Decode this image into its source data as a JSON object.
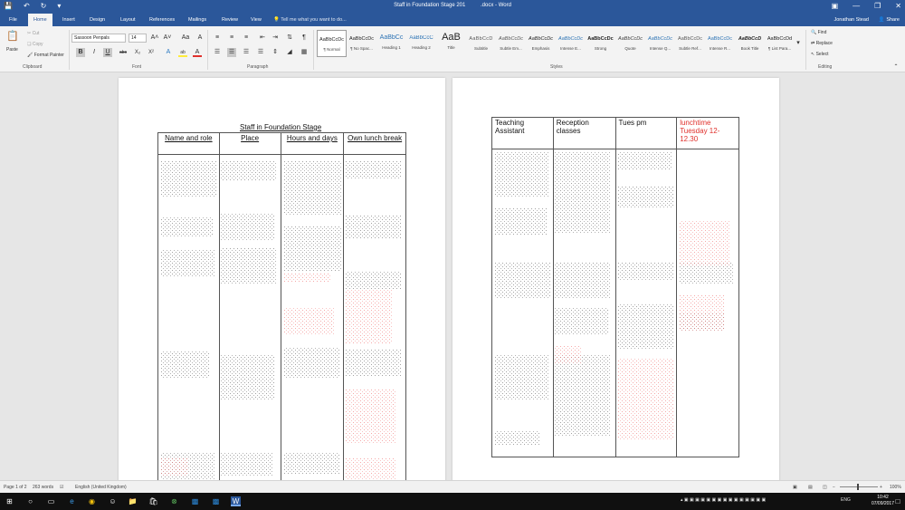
{
  "window": {
    "title": "Staff in Foundation Stage 201          .docx - Word",
    "minimize": "—",
    "restore": "❐",
    "close": "✕"
  },
  "tabs": [
    "File",
    "Home",
    "Insert",
    "Design",
    "Layout",
    "References",
    "Mailings",
    "Review",
    "View"
  ],
  "tell_me": "Tell me what you want to do...",
  "user": "Jonathan Stead",
  "share": "Share",
  "ribbon": {
    "clipboard": {
      "paste": "Paste",
      "cut": "Cut",
      "copy": "Copy",
      "format_painter": "Format Painter",
      "label": "Clipboard"
    },
    "font": {
      "name": "Sassoon Penpals",
      "size": "14",
      "label": "Font",
      "grow": "A˄",
      "shrink": "A˅",
      "case": "Aa",
      "clear": "A",
      "bold": "B",
      "italic": "I",
      "underline": "U",
      "strike": "abc",
      "sub": "X₂",
      "sup": "X²",
      "effects": "A",
      "highlight": "ab",
      "color": "A"
    },
    "paragraph": {
      "label": "Paragraph",
      "pilcrow": "¶"
    },
    "styles": {
      "label": "Styles",
      "items": [
        {
          "preview": "AaBbCcDc",
          "name": "¶ Normal"
        },
        {
          "preview": "AaBbCcDc",
          "name": "¶ No Spac..."
        },
        {
          "preview": "AaBbCc",
          "name": "Heading 1"
        },
        {
          "preview": "AaBbCcC",
          "name": "Heading 2"
        },
        {
          "preview": "AaB",
          "name": "Title"
        },
        {
          "preview": "AaBbCcD",
          "name": "Subtitle"
        },
        {
          "preview": "AaBbCcDc",
          "name": "Subtle Em..."
        },
        {
          "preview": "AaBbCcDc",
          "name": "Emphasis"
        },
        {
          "preview": "AaBbCcDc",
          "name": "Intense E..."
        },
        {
          "preview": "AaBbCcDc",
          "name": "Strong"
        },
        {
          "preview": "AaBbCcDc",
          "name": "Quote"
        },
        {
          "preview": "AaBbCcDc",
          "name": "Intense Q..."
        },
        {
          "preview": "AaBbCcDc",
          "name": "Subtle Ref..."
        },
        {
          "preview": "AaBbCcDc",
          "name": "Intense R..."
        },
        {
          "preview": "AaBbCcD",
          "name": "Book Title"
        },
        {
          "preview": "AaBbCcDd",
          "name": "¶ List Para..."
        }
      ]
    },
    "editing": {
      "find": "Find",
      "replace": "Replace",
      "select": "Select",
      "label": "Editing"
    }
  },
  "document": {
    "page1": {
      "title": "Staff in Foundation Stage",
      "headers": [
        "Name and role",
        "Place",
        "Hours and days",
        "Own lunch break"
      ]
    },
    "page2": {
      "headers": [
        "Teaching Assistant",
        "Reception classes",
        "Tues pm",
        "lunchtime Tuesday 12-12.30"
      ]
    }
  },
  "status": {
    "page": "Page 1 of 2",
    "words": "263 words",
    "language": "English (United Kingdom)",
    "zoom": "100%",
    "zoom_minus": "−",
    "zoom_plus": "+"
  },
  "taskbar": {
    "lang": "ENG",
    "time": "10:42",
    "date": "07/09/2017"
  }
}
